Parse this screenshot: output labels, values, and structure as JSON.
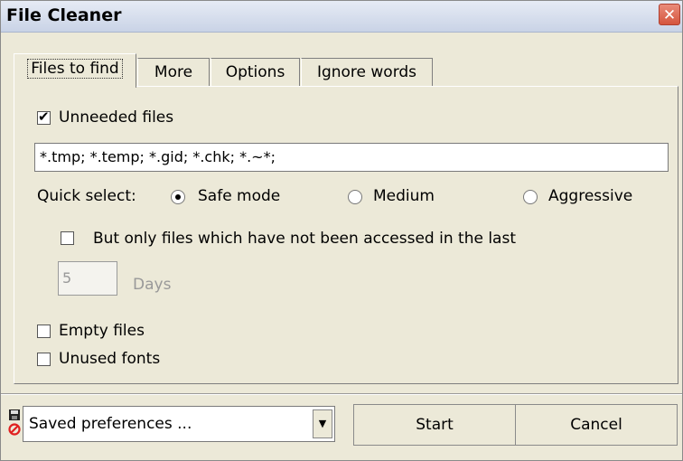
{
  "window": {
    "title": "File Cleaner",
    "close_label": "✕"
  },
  "tabs": [
    {
      "label": "Files to find",
      "active": true
    },
    {
      "label": "More",
      "active": false
    },
    {
      "label": "Options",
      "active": false
    },
    {
      "label": "Ignore words",
      "active": false
    }
  ],
  "files_tab": {
    "unneeded_files": {
      "label": "Unneeded files",
      "checked": true
    },
    "patterns_value": "*.tmp; *.temp; *.gid; *.chk; *.~*;",
    "quick_select_label": "Quick select:",
    "quick_select_options": [
      {
        "label": "Safe mode",
        "selected": true
      },
      {
        "label": "Medium",
        "selected": false
      },
      {
        "label": "Aggressive",
        "selected": false
      }
    ],
    "not_accessed": {
      "label": "But only files which have not been accessed in the last",
      "checked": false
    },
    "days_value": "5",
    "days_label": "Days",
    "empty_files": {
      "label": "Empty files",
      "checked": false
    },
    "unused_fonts": {
      "label": "Unused fonts",
      "checked": false
    }
  },
  "footer": {
    "preferences_value": "Saved preferences ...",
    "start_label": "Start",
    "cancel_label": "Cancel"
  },
  "colors": {
    "window_bg": "#ece9d8",
    "close_red": "#d5553d"
  }
}
